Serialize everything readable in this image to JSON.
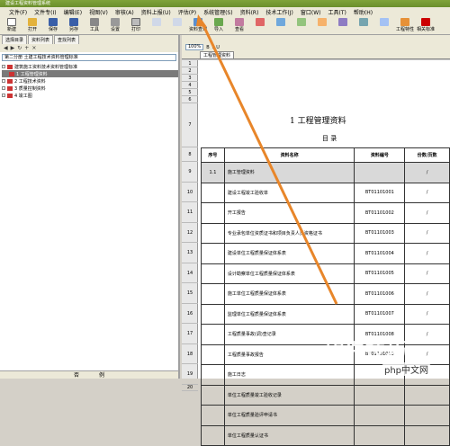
{
  "titlebar": "建设工程资料管理系统",
  "menu": [
    "文件(F)",
    "文件专(I)",
    "编辑(E)",
    "视图(V)",
    "审核(A)",
    "资料上报(U)",
    "评估(P)",
    "系统管理(S)",
    "资料(R)",
    "技术工作(J)",
    "窗口(W)",
    "工具(T)",
    "帮助(H)"
  ],
  "toolbar": [
    "新建",
    "打开",
    "保存",
    "另存",
    "工具",
    "设置",
    "打印",
    "",
    "",
    "资料查询",
    "导入",
    "查看",
    "",
    "",
    "",
    "",
    "",
    "",
    "",
    "工程特性",
    "相关标准"
  ],
  "left_tabs": [
    "选择目录",
    "资料列表",
    "查找列表"
  ],
  "left_select": "第二分册 土建工程技术资料管理标准",
  "tree": [
    {
      "label": "建筑施工资料技术资料管理标准"
    },
    {
      "label": "1 工程管理资料",
      "selected": true
    },
    {
      "label": "2 工程技术资料"
    },
    {
      "label": "3 质量控制资料"
    },
    {
      "label": "4 竣工图"
    }
  ],
  "left_footer": [
    "否",
    "例"
  ],
  "sheet_tab": "工程管理资料",
  "zoom": "100%",
  "sheet": {
    "title": "1 工程管理资料",
    "subtitle": "目 录",
    "headers": [
      "序号",
      "资料名称",
      "资料编号",
      "份数/页数"
    ],
    "rows": [
      {
        "idx": "1.1",
        "name": "施工管理资料",
        "code": "",
        "page": "/",
        "band": true
      },
      {
        "idx": "",
        "name": "建设工程竣工验收单",
        "code": "BT01101001",
        "page": "/"
      },
      {
        "idx": "",
        "name": "开工报告",
        "code": "BT01101002",
        "page": "/"
      },
      {
        "idx": "",
        "name": "专业承包单位资质证书和项目负责人员资格证书",
        "code": "BT01101003",
        "page": "/"
      },
      {
        "idx": "",
        "name": "建设单位工程质量保证体系表",
        "code": "BT01101004",
        "page": "/"
      },
      {
        "idx": "",
        "name": "设计勘察单位工程质量保证体系表",
        "code": "BT01101005",
        "page": "/"
      },
      {
        "idx": "",
        "name": "施工单位工程质量保证体系表",
        "code": "BT01101006",
        "page": "/"
      },
      {
        "idx": "",
        "name": "监理单位工程质量保证体系表",
        "code": "BT01101007",
        "page": "/"
      },
      {
        "idx": "",
        "name": "工程质量事故(调)查记录",
        "code": "BT01101008",
        "page": "/"
      },
      {
        "idx": "",
        "name": "工程质量事故报告",
        "code": "BT01101009",
        "page": "/"
      },
      {
        "idx": "",
        "name": "施工日志",
        "code": "",
        "page": ""
      },
      {
        "idx": "",
        "name": "单位工程质量竣工验收记录",
        "code": "",
        "page": ""
      },
      {
        "idx": "",
        "name": "单位工程质量验评申请书",
        "code": "",
        "page": ""
      },
      {
        "idx": "",
        "name": "单位工程质量认证书",
        "code": "",
        "page": ""
      }
    ]
  },
  "row_numbers": [
    "1",
    "2",
    "3",
    "4",
    "5",
    "6",
    "7",
    "8",
    "9",
    "10",
    "11",
    "12",
    "13",
    "14",
    "15",
    "16",
    "17",
    "18",
    "19",
    "20"
  ],
  "watermark": "软件技巧",
  "watermark_logo": "php中文网",
  "colors": {
    "accent": "#7fa33a",
    "arrow": "#e8862a"
  }
}
